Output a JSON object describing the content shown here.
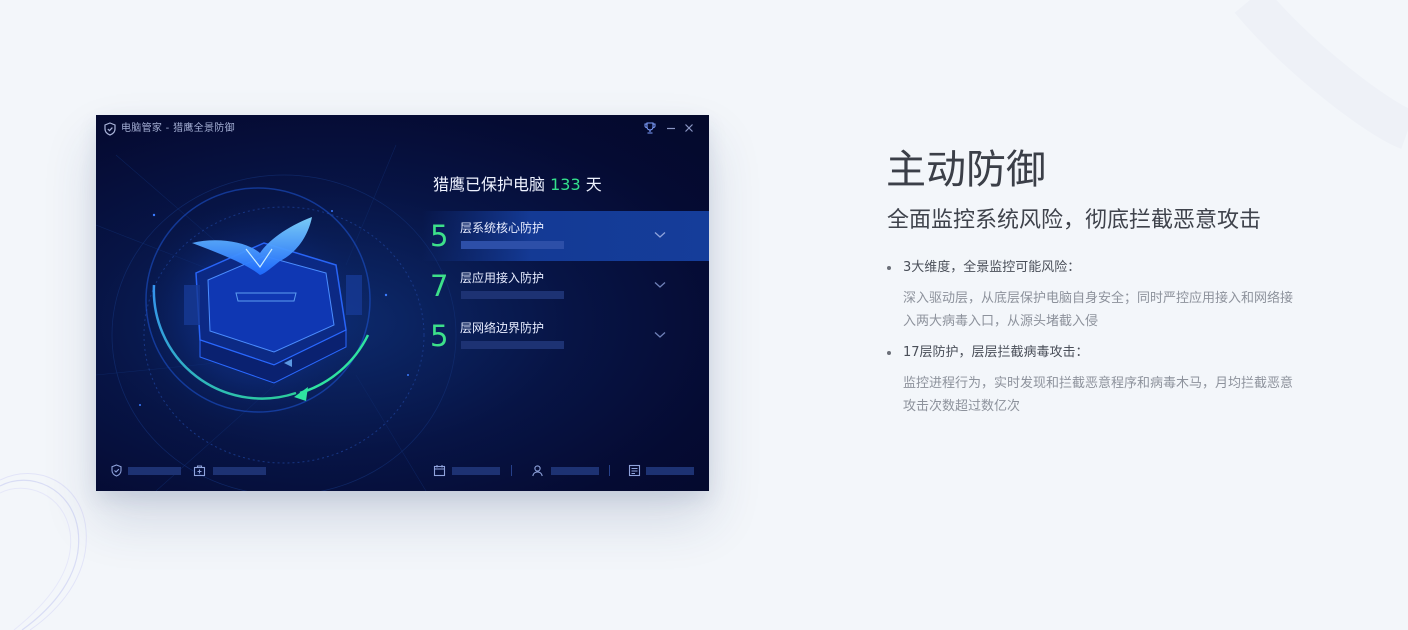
{
  "window": {
    "title": "电脑管家 - 猎鹰全景防御",
    "controls": {
      "trophy_icon": "trophy-icon",
      "minimize_icon": "minimize-icon",
      "close_icon": "close-icon"
    },
    "headline": {
      "prefix": "猎鹰已保护电脑",
      "days": "133",
      "suffix": "天"
    },
    "layers": [
      {
        "number": "5",
        "label": "层系统核心防护",
        "active": true
      },
      {
        "number": "7",
        "label": "层应用接入防护",
        "active": false
      },
      {
        "number": "5",
        "label": "层网络边界防护",
        "active": false
      }
    ],
    "bottom_icons": [
      "shield-check-icon",
      "toolbox-icon",
      "calendar-icon",
      "user-icon",
      "note-icon"
    ],
    "colors": {
      "accent_green": "#34e08c",
      "window_bg": "#050b33",
      "active_row": "#153d9a",
      "glow_blue": "#2f6bff"
    }
  },
  "feature": {
    "title": "主动防御",
    "subtitle": "全面监控系统风险，彻底拦截恶意攻击",
    "bullets": [
      {
        "heading": "3大维度，全景监控可能风险：",
        "body": "深入驱动层，从底层保护电脑自身安全；同时严控应用接入和网络接入两大病毒入口，从源头堵截入侵"
      },
      {
        "heading": "17层防护，层层拦截病毒攻击：",
        "body": "监控进程行为，实时发现和拦截恶意程序和病毒木马，月均拦截恶意攻击次数超过数亿次"
      }
    ]
  }
}
